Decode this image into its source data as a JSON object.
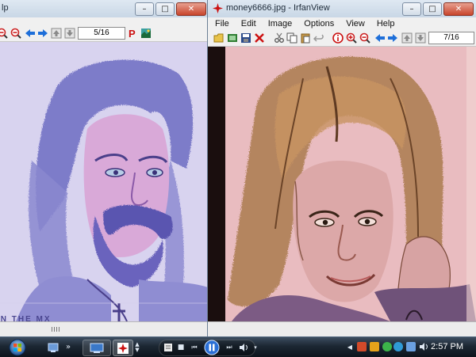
{
  "left_window": {
    "title_fragment": "lp",
    "page_indicator": "5/16",
    "caption_text": "IN THE MX"
  },
  "right_window": {
    "title": "money6666.jpg - IrfanView",
    "menu": [
      "File",
      "Edit",
      "Image",
      "Options",
      "View",
      "Help"
    ],
    "page_indicator": "7/16"
  },
  "window_controls": {
    "minimize": "–",
    "maximize": "□",
    "close": "✕"
  },
  "taskbar": {
    "clock": "2:57 PM",
    "quicklaunch_chevron": "»"
  },
  "colors": {
    "accent_red": "#cc1111",
    "nav_blue": "#1e6fd9",
    "right_image_bg": "#e9bcc0",
    "left_image_bg": "#e2def3"
  }
}
